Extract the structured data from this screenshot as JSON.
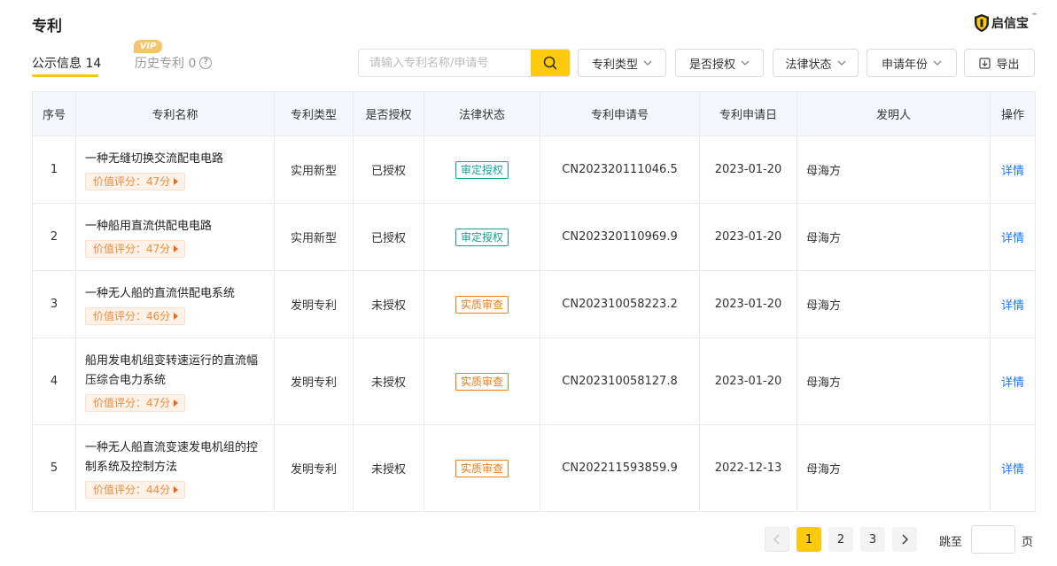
{
  "header": {
    "title": "专利",
    "brand_name": "启信宝",
    "brand_tm": "™"
  },
  "tabs": {
    "public": "公示信息 14",
    "history": "历史专利 0",
    "vip": "VIP",
    "help": "?"
  },
  "search": {
    "placeholder": "请输入专利名称/申请号"
  },
  "filters": {
    "patent_type": "专利类型",
    "authorized": "是否授权",
    "legal_status": "法律状态",
    "apply_year": "申请年份",
    "export": "导出"
  },
  "table": {
    "headers": [
      "序号",
      "专利名称",
      "专利类型",
      "是否授权",
      "法律状态",
      "专利申请号",
      "专利申请日",
      "发明人",
      "操作"
    ],
    "rows": [
      {
        "index": "1",
        "name": "一种无缝切换交流配电电路",
        "score": "价值评分：47分",
        "type": "实用新型",
        "authorized": "已授权",
        "status": "审定授权",
        "app_no": "CN202320111046.5",
        "date": "2023-01-20",
        "inventor": "母海方",
        "action": "详情"
      },
      {
        "index": "2",
        "name": "一种船用直流供配电电路",
        "score": "价值评分：47分",
        "type": "实用新型",
        "authorized": "已授权",
        "status": "审定授权",
        "app_no": "CN202320110969.9",
        "date": "2023-01-20",
        "inventor": "母海方",
        "action": "详情"
      },
      {
        "index": "3",
        "name": "一种无人船的直流供配电系统",
        "score": "价值评分：46分",
        "type": "发明专利",
        "authorized": "未授权",
        "status": "实质审查",
        "app_no": "CN202310058223.2",
        "date": "2023-01-20",
        "inventor": "母海方",
        "action": "详情"
      },
      {
        "index": "4",
        "name": "船用发电机组变转速运行的直流幅压综合电力系统",
        "score": "价值评分：47分",
        "type": "发明专利",
        "authorized": "未授权",
        "status": "实质审查",
        "app_no": "CN202310058127.8",
        "date": "2023-01-20",
        "inventor": "母海方",
        "action": "详情"
      },
      {
        "index": "5",
        "name": "一种无人船直流变速发电机组的控制系统及控制方法",
        "score": "价值评分：44分",
        "type": "发明专利",
        "authorized": "未授权",
        "status": "实质审查",
        "app_no": "CN202211593859.9",
        "date": "2022-12-13",
        "inventor": "母海方",
        "action": "详情"
      }
    ]
  },
  "pagination": {
    "pages": [
      "1",
      "2",
      "3"
    ],
    "current": "1",
    "jump_label": "跳至",
    "page_label": "页"
  },
  "colors": {
    "accent": "#fdca0e",
    "link": "#1677ff",
    "status_granted": "#1aa19a",
    "status_review": "#e77d1c"
  }
}
